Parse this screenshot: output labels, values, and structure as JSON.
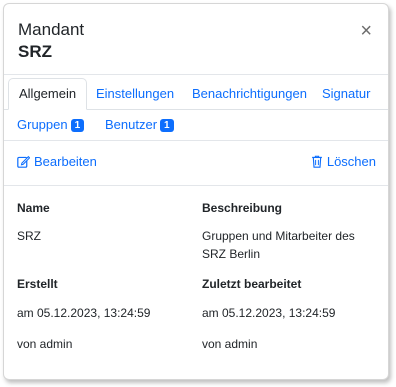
{
  "header": {
    "title": "Mandant",
    "subtitle": "SRZ",
    "close_label": "×"
  },
  "tabs": [
    {
      "label": "Allgemein",
      "active": true
    },
    {
      "label": "Einstellungen"
    },
    {
      "label": "Benachrichtigungen"
    },
    {
      "label": "Signatur"
    }
  ],
  "tabs_row2": [
    {
      "label": "Gruppen",
      "badge": "1"
    },
    {
      "label": "Benutzer",
      "badge": "1"
    }
  ],
  "actions": {
    "edit_label": "Bearbeiten",
    "delete_label": "Löschen",
    "edit_icon": "edit-icon",
    "delete_icon": "trash-icon",
    "accent_color": "#0d6efd"
  },
  "details": {
    "name_label": "Name",
    "name_value": "SRZ",
    "description_label": "Beschreibung",
    "description_value_line1": "Gruppen und Mitarbeiter des",
    "description_value_line2": "SRZ Berlin",
    "created_label": "Erstellt",
    "created_date": "am 05.12.2023, 13:24:59",
    "created_by": "von admin",
    "modified_label": "Zuletzt bearbeitet",
    "modified_date": "am 05.12.2023, 13:24:59",
    "modified_by": "von admin"
  }
}
